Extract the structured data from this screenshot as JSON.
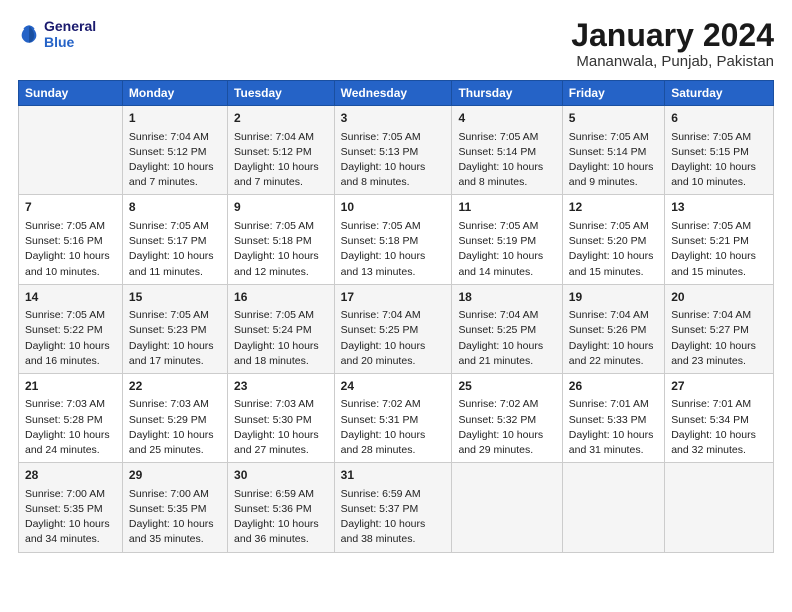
{
  "logo": {
    "line1": "General",
    "line2": "Blue"
  },
  "title": "January 2024",
  "subtitle": "Mananwala, Punjab, Pakistan",
  "headers": [
    "Sunday",
    "Monday",
    "Tuesday",
    "Wednesday",
    "Thursday",
    "Friday",
    "Saturday"
  ],
  "weeks": [
    [
      {
        "day": "",
        "sunrise": "",
        "sunset": "",
        "daylight": ""
      },
      {
        "day": "1",
        "sunrise": "Sunrise: 7:04 AM",
        "sunset": "Sunset: 5:12 PM",
        "daylight": "Daylight: 10 hours and 7 minutes."
      },
      {
        "day": "2",
        "sunrise": "Sunrise: 7:04 AM",
        "sunset": "Sunset: 5:12 PM",
        "daylight": "Daylight: 10 hours and 7 minutes."
      },
      {
        "day": "3",
        "sunrise": "Sunrise: 7:05 AM",
        "sunset": "Sunset: 5:13 PM",
        "daylight": "Daylight: 10 hours and 8 minutes."
      },
      {
        "day": "4",
        "sunrise": "Sunrise: 7:05 AM",
        "sunset": "Sunset: 5:14 PM",
        "daylight": "Daylight: 10 hours and 8 minutes."
      },
      {
        "day": "5",
        "sunrise": "Sunrise: 7:05 AM",
        "sunset": "Sunset: 5:14 PM",
        "daylight": "Daylight: 10 hours and 9 minutes."
      },
      {
        "day": "6",
        "sunrise": "Sunrise: 7:05 AM",
        "sunset": "Sunset: 5:15 PM",
        "daylight": "Daylight: 10 hours and 10 minutes."
      }
    ],
    [
      {
        "day": "7",
        "sunrise": "Sunrise: 7:05 AM",
        "sunset": "Sunset: 5:16 PM",
        "daylight": "Daylight: 10 hours and 10 minutes."
      },
      {
        "day": "8",
        "sunrise": "Sunrise: 7:05 AM",
        "sunset": "Sunset: 5:17 PM",
        "daylight": "Daylight: 10 hours and 11 minutes."
      },
      {
        "day": "9",
        "sunrise": "Sunrise: 7:05 AM",
        "sunset": "Sunset: 5:18 PM",
        "daylight": "Daylight: 10 hours and 12 minutes."
      },
      {
        "day": "10",
        "sunrise": "Sunrise: 7:05 AM",
        "sunset": "Sunset: 5:18 PM",
        "daylight": "Daylight: 10 hours and 13 minutes."
      },
      {
        "day": "11",
        "sunrise": "Sunrise: 7:05 AM",
        "sunset": "Sunset: 5:19 PM",
        "daylight": "Daylight: 10 hours and 14 minutes."
      },
      {
        "day": "12",
        "sunrise": "Sunrise: 7:05 AM",
        "sunset": "Sunset: 5:20 PM",
        "daylight": "Daylight: 10 hours and 15 minutes."
      },
      {
        "day": "13",
        "sunrise": "Sunrise: 7:05 AM",
        "sunset": "Sunset: 5:21 PM",
        "daylight": "Daylight: 10 hours and 15 minutes."
      }
    ],
    [
      {
        "day": "14",
        "sunrise": "Sunrise: 7:05 AM",
        "sunset": "Sunset: 5:22 PM",
        "daylight": "Daylight: 10 hours and 16 minutes."
      },
      {
        "day": "15",
        "sunrise": "Sunrise: 7:05 AM",
        "sunset": "Sunset: 5:23 PM",
        "daylight": "Daylight: 10 hours and 17 minutes."
      },
      {
        "day": "16",
        "sunrise": "Sunrise: 7:05 AM",
        "sunset": "Sunset: 5:24 PM",
        "daylight": "Daylight: 10 hours and 18 minutes."
      },
      {
        "day": "17",
        "sunrise": "Sunrise: 7:04 AM",
        "sunset": "Sunset: 5:25 PM",
        "daylight": "Daylight: 10 hours and 20 minutes."
      },
      {
        "day": "18",
        "sunrise": "Sunrise: 7:04 AM",
        "sunset": "Sunset: 5:25 PM",
        "daylight": "Daylight: 10 hours and 21 minutes."
      },
      {
        "day": "19",
        "sunrise": "Sunrise: 7:04 AM",
        "sunset": "Sunset: 5:26 PM",
        "daylight": "Daylight: 10 hours and 22 minutes."
      },
      {
        "day": "20",
        "sunrise": "Sunrise: 7:04 AM",
        "sunset": "Sunset: 5:27 PM",
        "daylight": "Daylight: 10 hours and 23 minutes."
      }
    ],
    [
      {
        "day": "21",
        "sunrise": "Sunrise: 7:03 AM",
        "sunset": "Sunset: 5:28 PM",
        "daylight": "Daylight: 10 hours and 24 minutes."
      },
      {
        "day": "22",
        "sunrise": "Sunrise: 7:03 AM",
        "sunset": "Sunset: 5:29 PM",
        "daylight": "Daylight: 10 hours and 25 minutes."
      },
      {
        "day": "23",
        "sunrise": "Sunrise: 7:03 AM",
        "sunset": "Sunset: 5:30 PM",
        "daylight": "Daylight: 10 hours and 27 minutes."
      },
      {
        "day": "24",
        "sunrise": "Sunrise: 7:02 AM",
        "sunset": "Sunset: 5:31 PM",
        "daylight": "Daylight: 10 hours and 28 minutes."
      },
      {
        "day": "25",
        "sunrise": "Sunrise: 7:02 AM",
        "sunset": "Sunset: 5:32 PM",
        "daylight": "Daylight: 10 hours and 29 minutes."
      },
      {
        "day": "26",
        "sunrise": "Sunrise: 7:01 AM",
        "sunset": "Sunset: 5:33 PM",
        "daylight": "Daylight: 10 hours and 31 minutes."
      },
      {
        "day": "27",
        "sunrise": "Sunrise: 7:01 AM",
        "sunset": "Sunset: 5:34 PM",
        "daylight": "Daylight: 10 hours and 32 minutes."
      }
    ],
    [
      {
        "day": "28",
        "sunrise": "Sunrise: 7:00 AM",
        "sunset": "Sunset: 5:35 PM",
        "daylight": "Daylight: 10 hours and 34 minutes."
      },
      {
        "day": "29",
        "sunrise": "Sunrise: 7:00 AM",
        "sunset": "Sunset: 5:35 PM",
        "daylight": "Daylight: 10 hours and 35 minutes."
      },
      {
        "day": "30",
        "sunrise": "Sunrise: 6:59 AM",
        "sunset": "Sunset: 5:36 PM",
        "daylight": "Daylight: 10 hours and 36 minutes."
      },
      {
        "day": "31",
        "sunrise": "Sunrise: 6:59 AM",
        "sunset": "Sunset: 5:37 PM",
        "daylight": "Daylight: 10 hours and 38 minutes."
      },
      {
        "day": "",
        "sunrise": "",
        "sunset": "",
        "daylight": ""
      },
      {
        "day": "",
        "sunrise": "",
        "sunset": "",
        "daylight": ""
      },
      {
        "day": "",
        "sunrise": "",
        "sunset": "",
        "daylight": ""
      }
    ]
  ]
}
